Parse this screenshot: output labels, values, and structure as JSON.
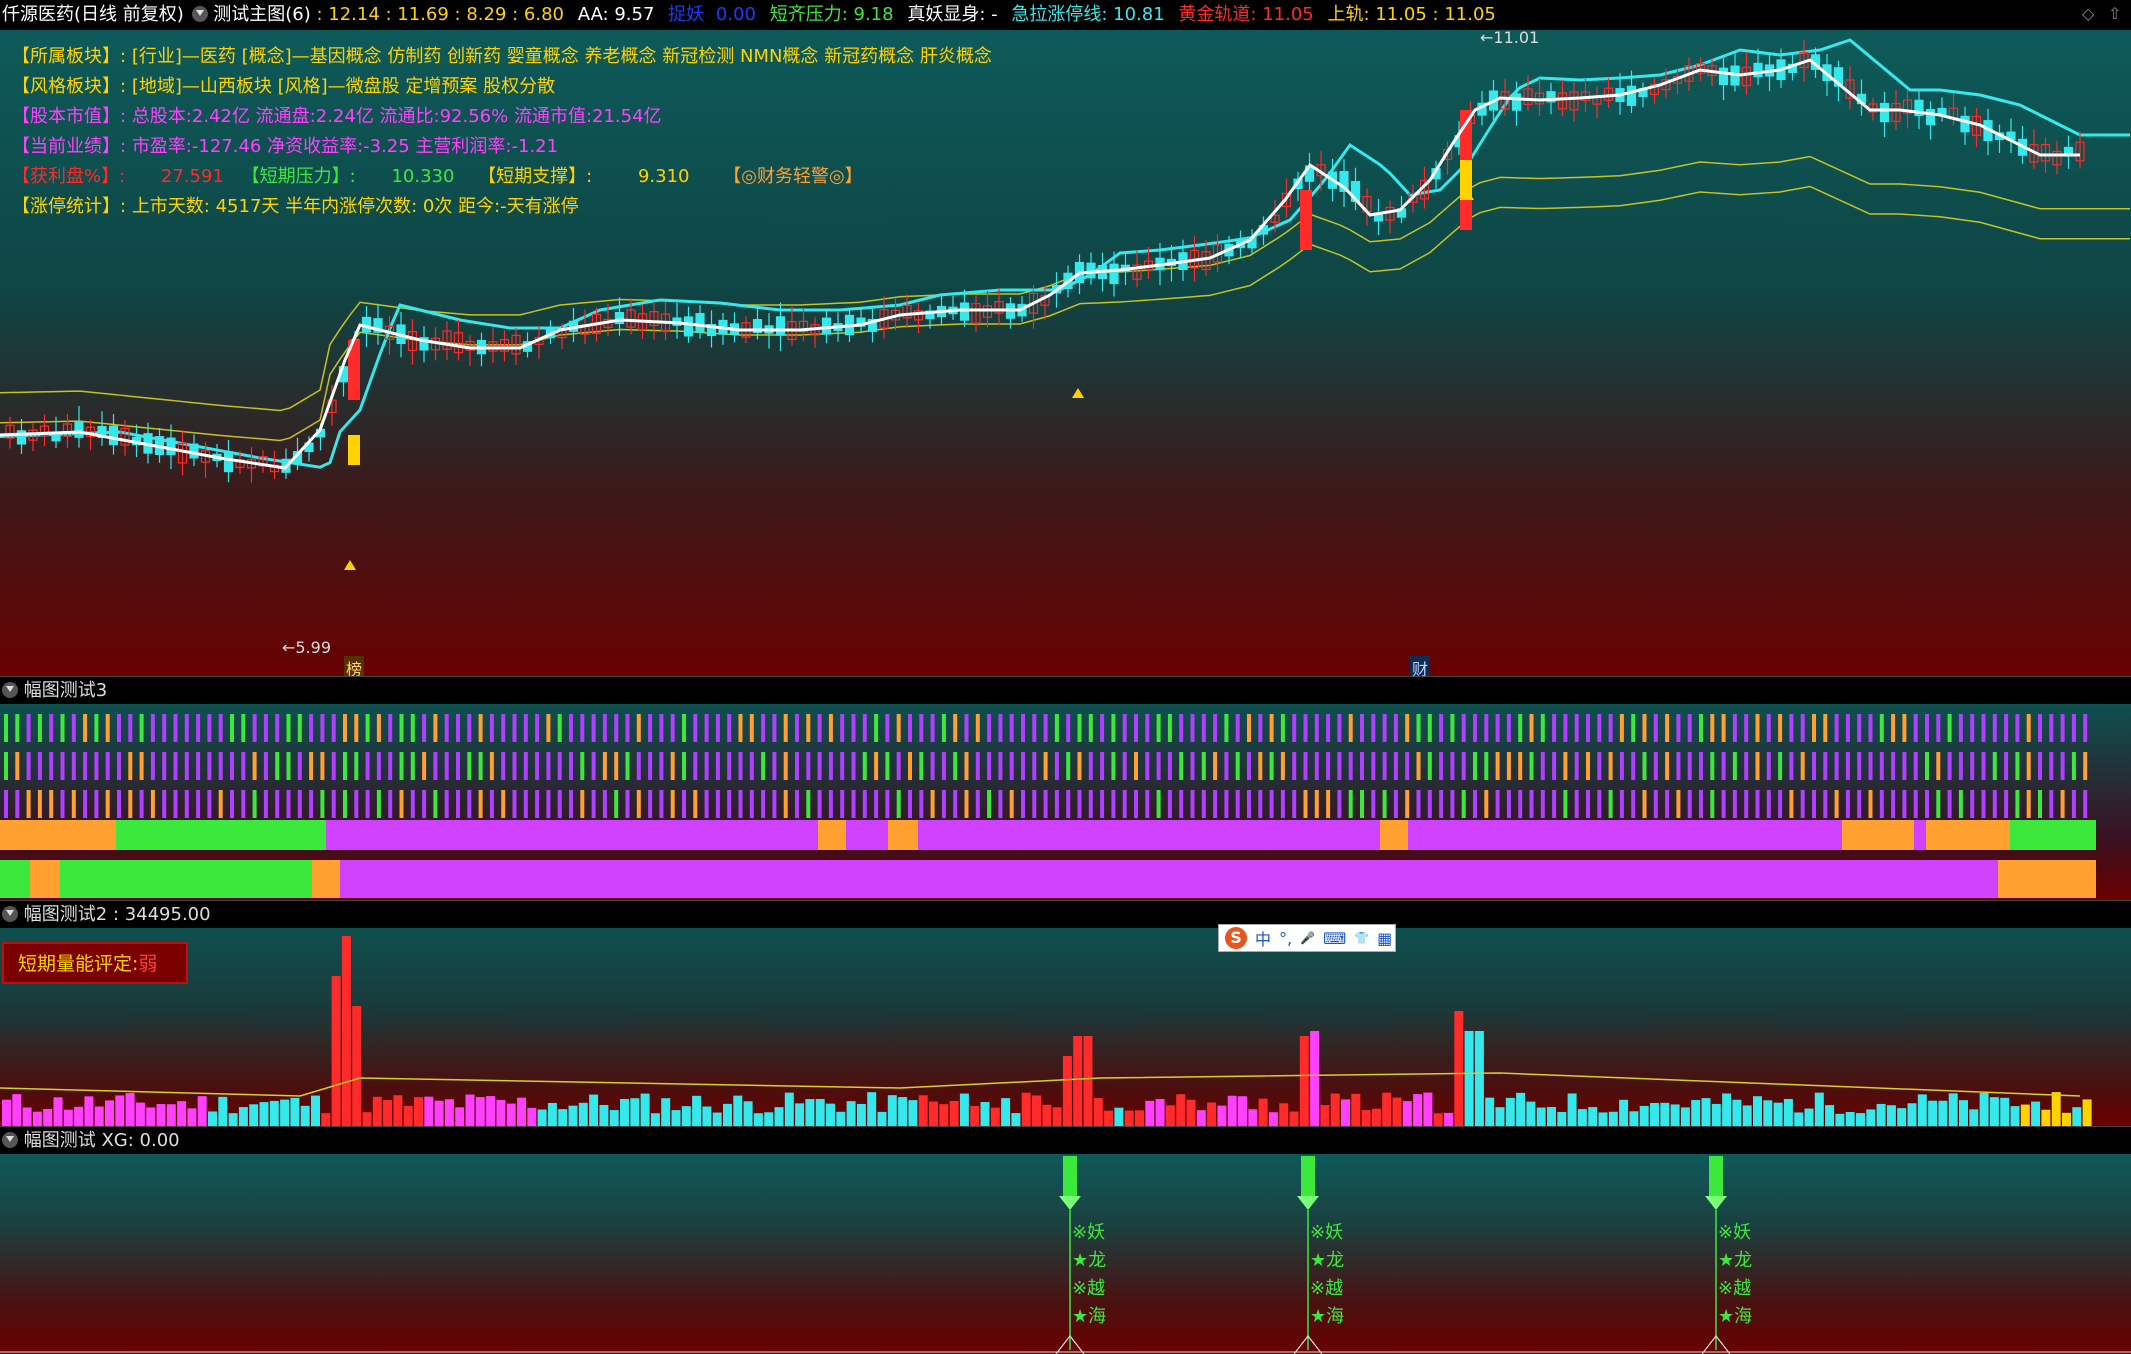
{
  "colors": {
    "up": "#ff2a2a",
    "down": "#35e8ec",
    "yellow": "#ffd200",
    "green": "#3de83d",
    "magenta": "#ff40ff",
    "orange": "#ffa030",
    "white": "#ffffff",
    "grid_bg_top": "#0e5a5a",
    "grid_bg_bottom": "#6b0000"
  },
  "main_header": {
    "stock": "仟源医药(日线 前复权)",
    "indicator": "测试主图(6)",
    "values": ": 12.14 : 11.69 : 8.29 : 6.80",
    "aa": "AA: 9.57",
    "hidden_label": "捉妖",
    "hidden_value": "0.00",
    "short_pressure": "短齐压力: 9.18",
    "true_demon": "真妖显身: -",
    "limit_line": "急拉涨停线: 10.81",
    "golden_label": "黄金轨道:",
    "golden_value": "11.05",
    "upper_label": "上轨:",
    "upper_value": "11.05 : 11.05"
  },
  "info": {
    "sector_label": "【所属板块】:",
    "sector_value": "[行业]—医药 [概念]—基因概念 仿制药 创新药 婴童概念 养老概念 新冠检测 NMN概念 新冠药概念 肝炎概念",
    "style_label": "【风格板块】:",
    "style_value": "[地域]—山西板块 [风格]—微盘股 定增预案 股权分散",
    "equity_label": "【股本市值】:",
    "equity_value": "总股本:2.42亿 流通盘:2.24亿 流通比:92.56% 流通市值:21.54亿",
    "perf_label": "【当前业绩】:",
    "perf_value": "市盈率:-127.46 净资收益率:-3.25 主营利润率:-1.21",
    "profit_label": "【获利盘%】:",
    "profit_value": "27.591",
    "pressure_label": "【短期压力】:",
    "pressure_value": "10.330",
    "support_label": "【短期支撑】:",
    "support_value": "9.310",
    "warn_label": "【◎财务轻警◎】",
    "limit_label": "【涨停统计】:",
    "limit_value": "上市天数: 4517天 半年内涨停次数: 0次   距今:-天有涨停"
  },
  "chart_marks": {
    "high_label": "11.01",
    "low_label": "5.99",
    "bottom_tag_1": "榜",
    "bottom_tag_2": "财"
  },
  "pane2": {
    "title": "幅图测试3"
  },
  "pane3": {
    "title": "幅图测试2 : 34495.00",
    "badge_label": "短期量能评定:",
    "badge_value": "弱"
  },
  "pane4": {
    "title": "幅图测试 XG: 0.00",
    "signal_chars": [
      "※妖",
      "★龙",
      "※越",
      "★海"
    ]
  },
  "ime": {
    "zh": "中",
    "punct": "°,",
    "mic": "🎤",
    "kb": "⌨",
    "shirt": "👕",
    "grid": "▦"
  }
}
